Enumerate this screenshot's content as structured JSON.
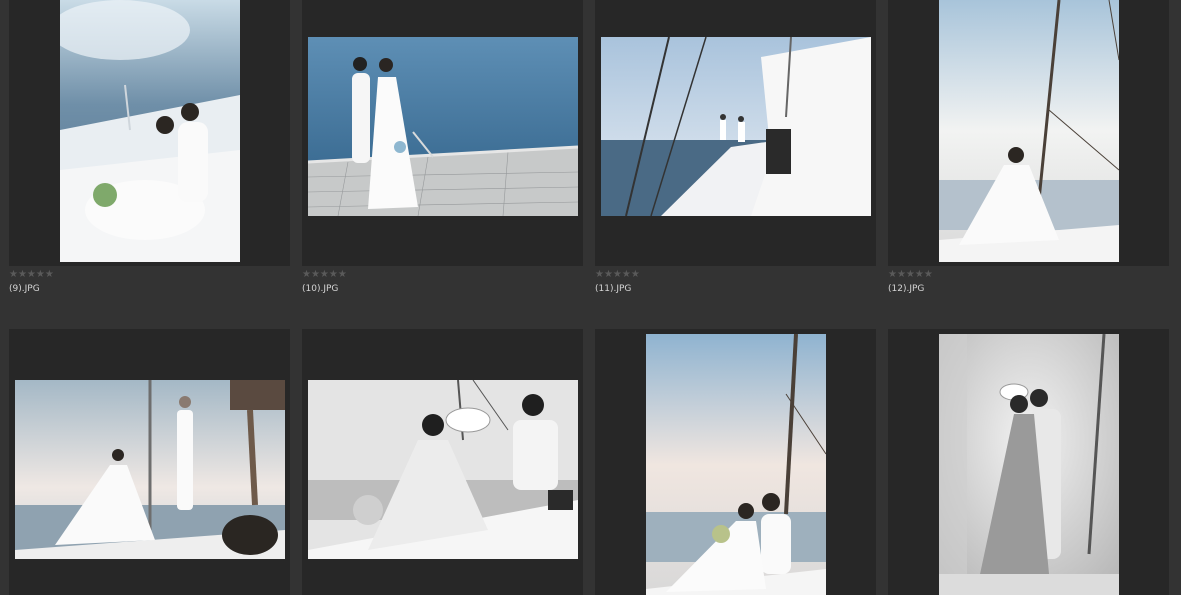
{
  "grid": {
    "thumbnails": [
      {
        "filename": "(9).JPG",
        "rating": "★★★★★",
        "orientation": "portrait",
        "tone": "color"
      },
      {
        "filename": "(10).JPG",
        "rating": "★★★★★",
        "orientation": "landscape",
        "tone": "color"
      },
      {
        "filename": "(11).JPG",
        "rating": "★★★★★",
        "orientation": "landscape",
        "tone": "color"
      },
      {
        "filename": "(12).JPG",
        "rating": "★★★★★",
        "orientation": "portrait",
        "tone": "color"
      },
      {
        "filename": "",
        "rating": "",
        "orientation": "landscape",
        "tone": "color"
      },
      {
        "filename": "",
        "rating": "",
        "orientation": "landscape",
        "tone": "mono"
      },
      {
        "filename": "",
        "rating": "",
        "orientation": "portrait",
        "tone": "color"
      },
      {
        "filename": "",
        "rating": "",
        "orientation": "portrait",
        "tone": "mono"
      }
    ]
  }
}
